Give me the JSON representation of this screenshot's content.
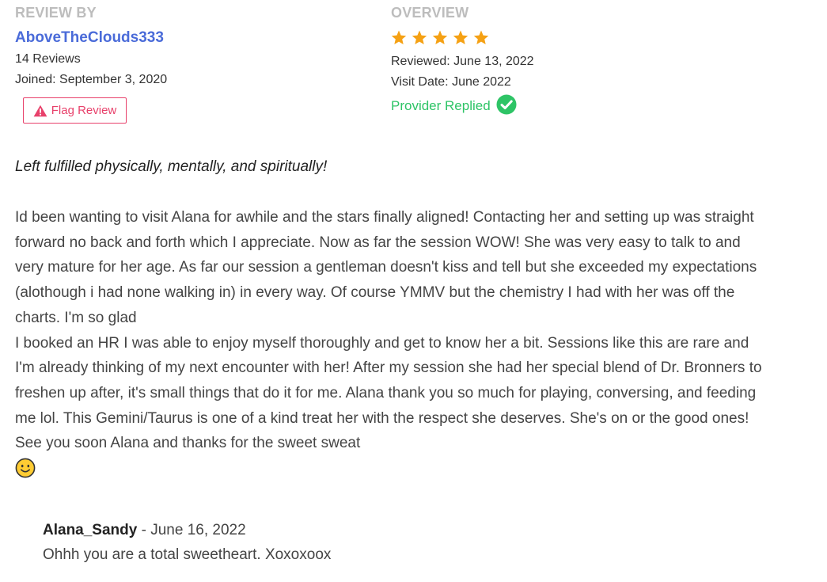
{
  "review_by": {
    "heading": "REVIEW BY",
    "reviewer_name": "AboveTheClouds333",
    "reviews_count": "14 Reviews",
    "joined": "Joined: September 3, 2020",
    "flag_button_label": "Flag Review"
  },
  "overview": {
    "heading": "OVERVIEW",
    "rating": 5,
    "rating_max": 5,
    "reviewed": "Reviewed: June 13, 2022",
    "visit_date": "Visit Date: June 2022",
    "provider_replied": "Provider Replied"
  },
  "review": {
    "title": "Left fulfilled physically, mentally, and spiritually!",
    "paragraph_1": "Id been wanting to visit Alana for awhile and the stars finally aligned! Contacting her and setting up was straight forward no back and forth which I appreciate. Now as far the session WOW! She was very easy to talk to and very mature for her age. As far our session a gentleman doesn't kiss and tell but she exceeded my expectations (alothough i had none walking in) in every way. Of course YMMV but the chemistry I had with her was off the charts. I'm so glad",
    "paragraph_2": "I booked an HR I was able to enjoy myself thoroughly and get to know her a bit. Sessions like this are rare and I'm already thinking of my next encounter with her! After my session she had her special blend of Dr. Bronners to freshen up after, it's small things that do it for me. Alana thank you so much for playing, conversing, and feeding me lol. This Gemini/Taurus is one of a kind treat her with the respect she deserves. She's on or the good ones! See you soon Alana and thanks for the sweet sweat",
    "emoji": "smiling-face-icon"
  },
  "reply": {
    "author": "Alana_Sandy",
    "separator": " - ",
    "date": "June 16, 2022",
    "body": "Ohhh you are a total sweetheart. Xoxoxoox"
  },
  "colors": {
    "heading_gray": "#bdbdbd",
    "reviewer_link": "#4a6bd9",
    "flag_red": "#e8416b",
    "star_orange": "#f5a114",
    "replied_green": "#2ec466",
    "emoji_yellow": "#ffcc33"
  }
}
